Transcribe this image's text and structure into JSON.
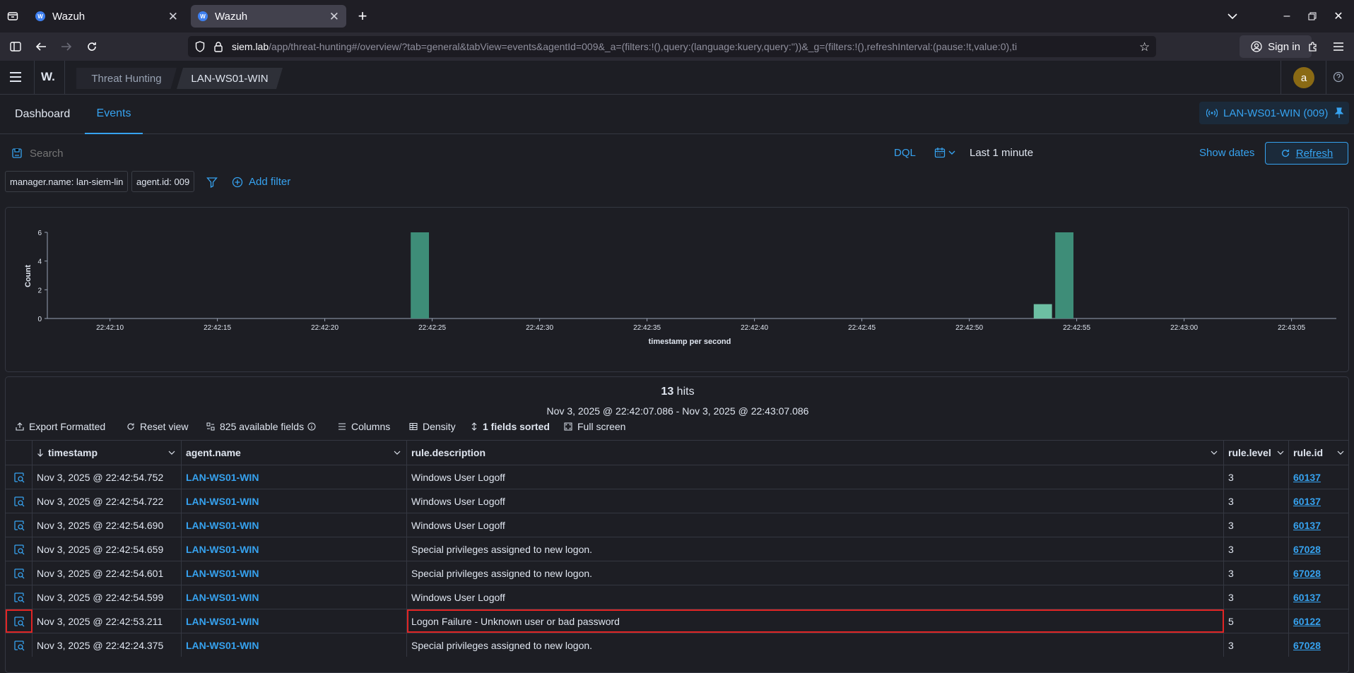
{
  "browser": {
    "tabs": [
      {
        "title": "Wazuh"
      },
      {
        "title": "Wazuh"
      }
    ],
    "url_host": "siem.lab",
    "url_path": "/app/threat-hunting#/overview/?tab=general&tabView=events&agentId=009&_a=(filters:!(),query:(language:kuery,query:''))&_g=(filters:!(),refreshInterval:(pause:!t,value:0),ti",
    "signin_label": "Sign in"
  },
  "app": {
    "logo": "W.",
    "breadcrumbs": [
      "Threat Hunting",
      "LAN-WS01-WIN"
    ],
    "avatar_letter": "a",
    "tabs": [
      "Dashboard",
      "Events"
    ],
    "active_tab": "Events",
    "agent_pill": "LAN-WS01-WIN (009)"
  },
  "query": {
    "placeholder": "Search",
    "dql_label": "DQL",
    "time_range": "Last 1 minute",
    "show_dates_label": "Show dates",
    "refresh_label": "Refresh"
  },
  "filters": {
    "items": [
      "manager.name: lan-siem-lin",
      "agent.id: 009"
    ],
    "add_filter_label": "Add filter"
  },
  "chart_data": {
    "type": "bar",
    "xlabel": "timestamp per second",
    "ylabel": "Count",
    "ylim": [
      0,
      6
    ],
    "yticks": [
      0,
      2,
      4,
      6
    ],
    "x_ticks": [
      "22:42:10",
      "22:42:15",
      "22:42:20",
      "22:42:25",
      "22:42:30",
      "22:42:35",
      "22:42:40",
      "22:42:45",
      "22:42:50",
      "22:42:55",
      "22:43:00",
      "22:43:05"
    ],
    "x_range_seconds": [
      0,
      60
    ],
    "bars": [
      {
        "x": "22:42:24",
        "value": 6
      },
      {
        "x": "22:42:53",
        "value": 1
      },
      {
        "x": "22:42:54",
        "value": 6
      }
    ],
    "colors": {
      "bar": "#3e8d78",
      "bar_light": "#6dbfa3"
    }
  },
  "table": {
    "hits_count": "13",
    "hits_label": "hits",
    "range_text": "Nov 3, 2025 @ 22:42:07.086 - Nov 3, 2025 @ 22:43:07.086",
    "toolbar": [
      "Export Formatted",
      "Reset view",
      "825 available fields",
      "Columns",
      "Density",
      "1 fields sorted",
      "Full screen"
    ],
    "columns": [
      "timestamp",
      "agent.name",
      "rule.description",
      "rule.level",
      "rule.id"
    ],
    "rows": [
      {
        "timestamp": "Nov 3, 2025 @ 22:42:54.752",
        "agent": "LAN-WS01-WIN",
        "description": "Windows User Logoff",
        "level": "3",
        "id": "60137"
      },
      {
        "timestamp": "Nov 3, 2025 @ 22:42:54.722",
        "agent": "LAN-WS01-WIN",
        "description": "Windows User Logoff",
        "level": "3",
        "id": "60137"
      },
      {
        "timestamp": "Nov 3, 2025 @ 22:42:54.690",
        "agent": "LAN-WS01-WIN",
        "description": "Windows User Logoff",
        "level": "3",
        "id": "60137"
      },
      {
        "timestamp": "Nov 3, 2025 @ 22:42:54.659",
        "agent": "LAN-WS01-WIN",
        "description": "Special privileges assigned to new logon.",
        "level": "3",
        "id": "67028"
      },
      {
        "timestamp": "Nov 3, 2025 @ 22:42:54.601",
        "agent": "LAN-WS01-WIN",
        "description": "Special privileges assigned to new logon.",
        "level": "3",
        "id": "67028"
      },
      {
        "timestamp": "Nov 3, 2025 @ 22:42:54.599",
        "agent": "LAN-WS01-WIN",
        "description": "Windows User Logoff",
        "level": "3",
        "id": "60137"
      },
      {
        "timestamp": "Nov 3, 2025 @ 22:42:53.211",
        "agent": "LAN-WS01-WIN",
        "description": "Logon Failure - Unknown user or bad password",
        "level": "5",
        "id": "60122"
      },
      {
        "timestamp": "Nov 3, 2025 @ 22:42:24.375",
        "agent": "LAN-WS01-WIN",
        "description": "Special privileges assigned to new logon.",
        "level": "3",
        "id": "67028"
      }
    ]
  }
}
